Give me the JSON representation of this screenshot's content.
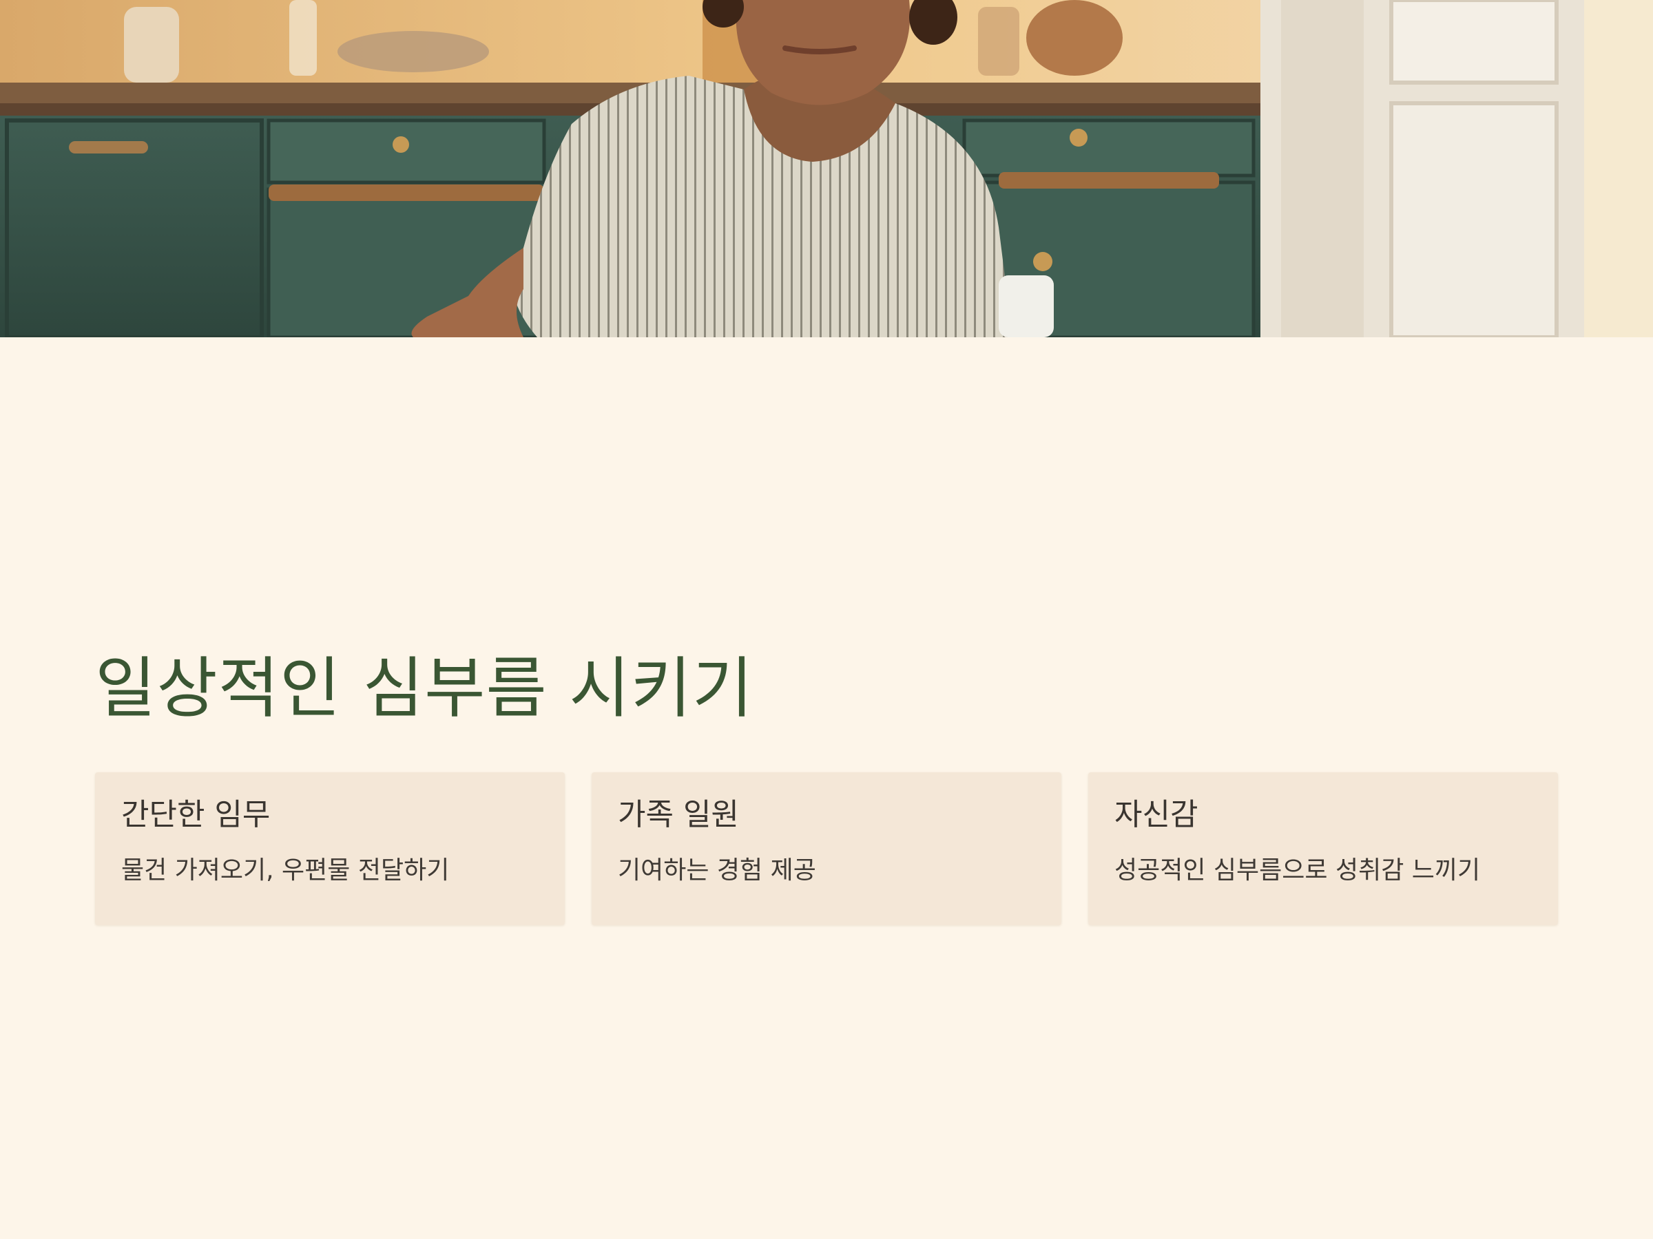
{
  "hero": {
    "image_description_icon": "child-doing-chore-photo",
    "colors": {
      "cabinet": "#3e5a4f",
      "countertop": "#8a6a48",
      "wall": "#e8c38f",
      "shirt": "#d8d3c4"
    }
  },
  "title": "일상적인 심부름 시키기",
  "colors": {
    "background": "#fdf5e9",
    "title": "#3a5633",
    "card_bg": "#f4e7d7",
    "card_text": "#3a3530"
  },
  "cards": [
    {
      "title": "간단한 임무",
      "description": "물건 가져오기, 우편물 전달하기"
    },
    {
      "title": "가족 일원",
      "description": "기여하는 경험 제공"
    },
    {
      "title": "자신감",
      "description": "성공적인 심부름으로 성취감 느끼기"
    }
  ]
}
